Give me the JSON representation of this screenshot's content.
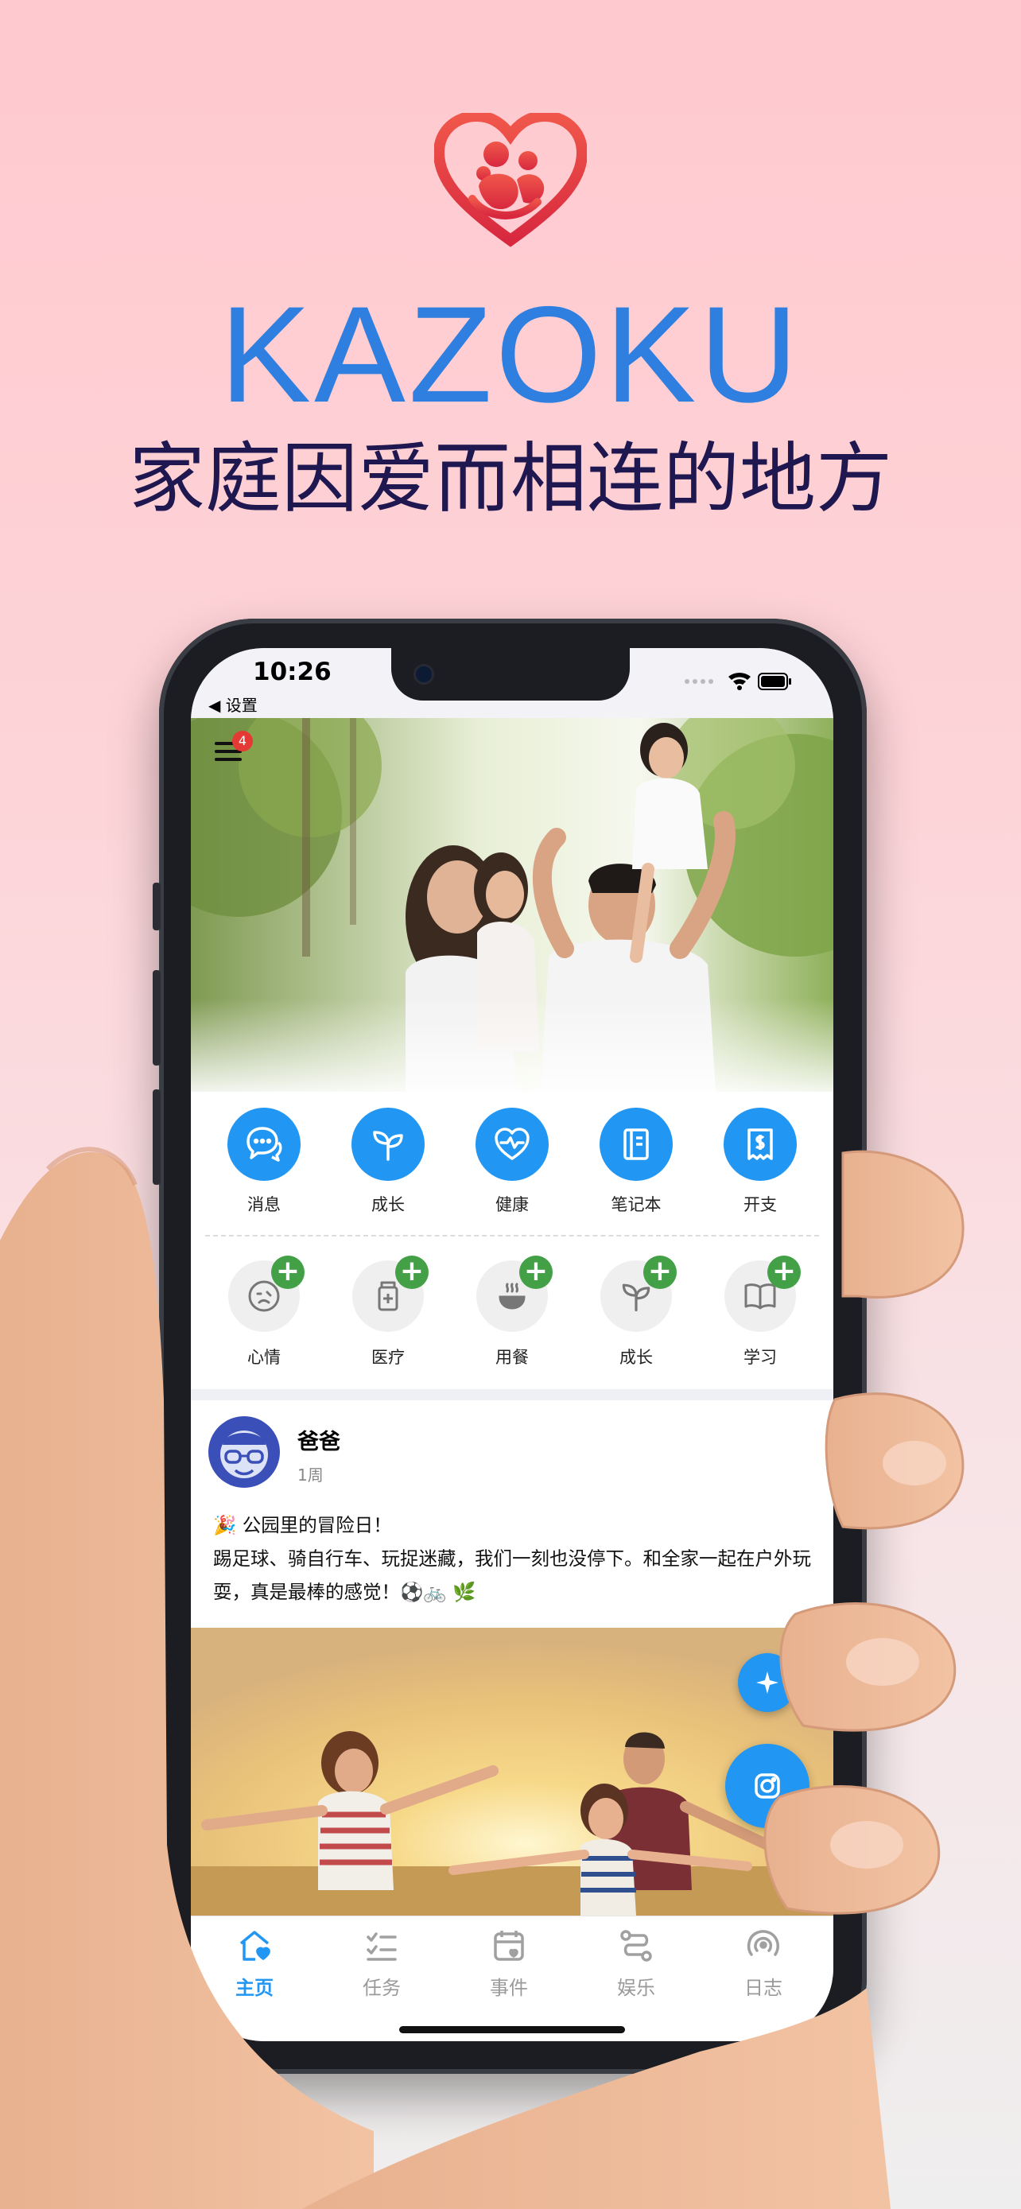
{
  "promo": {
    "brand": "KAZOKU",
    "slogan": "家庭因爱而相连的地方",
    "logo_icon": "heart-family-icon",
    "brand_color": "#2f7fe0",
    "slogan_color": "#1f174f"
  },
  "status_bar": {
    "time": "10:26",
    "back_label": "◀ 设置"
  },
  "header": {
    "menu_icon": "hamburger-icon",
    "notification_count": "4"
  },
  "features": [
    {
      "label": "消息",
      "icon": "chat-bubbles-icon"
    },
    {
      "label": "成长",
      "icon": "sprout-icon"
    },
    {
      "label": "健康",
      "icon": "heart-pulse-icon"
    },
    {
      "label": "笔记本",
      "icon": "notebook-icon"
    },
    {
      "label": "开支",
      "icon": "receipt-dollar-icon"
    }
  ],
  "quick_add": [
    {
      "label": "心情",
      "icon": "mood-face-icon"
    },
    {
      "label": "医疗",
      "icon": "medicine-icon"
    },
    {
      "label": "用餐",
      "icon": "meal-bowl-icon"
    },
    {
      "label": "成长",
      "icon": "sprout-icon"
    },
    {
      "label": "学习",
      "icon": "open-book-icon"
    }
  ],
  "post": {
    "author": "爸爸",
    "time_ago": "1周",
    "line1": "🎉 公园里的冒险日！",
    "line2": "踢足球、骑自行车、玩捉迷藏，我们一刻也没停下。和全家一起在户外玩耍，真是最棒的感觉！⚽🚲 🌿"
  },
  "tabs": [
    {
      "label": "主页",
      "icon": "home-heart-icon",
      "active": true
    },
    {
      "label": "任务",
      "icon": "checklist-icon",
      "active": false
    },
    {
      "label": "事件",
      "icon": "calendar-icon",
      "active": false
    },
    {
      "label": "娱乐",
      "icon": "route-icon",
      "active": false
    },
    {
      "label": "日志",
      "icon": "broadcast-icon",
      "active": false
    }
  ],
  "colors": {
    "accent": "#2196f3",
    "add_green": "#43a047",
    "badge_red": "#e53935"
  }
}
